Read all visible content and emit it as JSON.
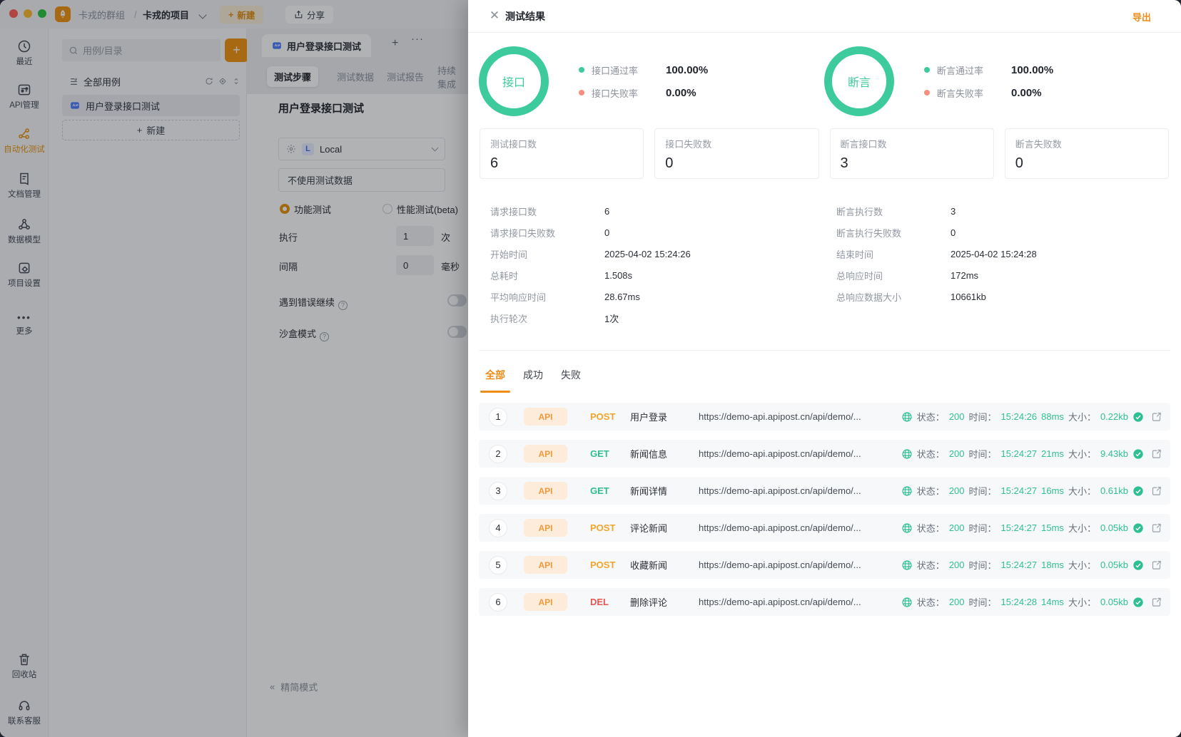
{
  "colors": {
    "primary_orange": "#f0940f",
    "accent_orange": "#ef8c1a",
    "success_green": "#3dcb9d",
    "fail_salmon": "#f88e7d",
    "method_post": "#f2a52a",
    "method_get": "#2fbe8f",
    "method_del": "#e8564f",
    "status_green": "#2fbf93"
  },
  "window_bar": {
    "group": "卡戎的群组",
    "separator": "/",
    "project": "卡戎的项目",
    "new_button": "新建",
    "share_button": "分享"
  },
  "sidebar": {
    "items": [
      {
        "label": "最近"
      },
      {
        "label": "API管理"
      },
      {
        "label": "自动化测试",
        "active": true
      },
      {
        "label": "文档管理"
      },
      {
        "label": "数据模型"
      },
      {
        "label": "项目设置"
      },
      {
        "label": "更多"
      }
    ],
    "bottom_items": [
      {
        "label": "回收站"
      },
      {
        "label": "联系客服"
      }
    ]
  },
  "tree_panel": {
    "search_placeholder": "用例/目录",
    "all_cases": "全部用例",
    "case_name": "用户登录接口测试",
    "new_label": "新建"
  },
  "editor_panel": {
    "doc_tab": "用户登录接口测试",
    "tabs": [
      "测试步骤",
      "测试数据",
      "测试报告",
      "持续集成"
    ],
    "heading": "用户登录接口测试",
    "env_badge": "L",
    "env_name": "Local",
    "data_source": "不使用测试数据",
    "mode_functional": "功能测试",
    "mode_performance": "性能测试(beta)",
    "exec_label": "执行",
    "exec_value": "1",
    "exec_unit": "次",
    "interval_label": "间隔",
    "interval_value": "0",
    "interval_unit": "毫秒",
    "continue_on_error": "遇到错误继续",
    "sandbox_mode": "沙盒模式",
    "compact_mode": "精简模式"
  },
  "modal": {
    "title": "测试结果",
    "export_label": "导出",
    "gauges": [
      {
        "ring_label": "接口",
        "pass_label": "接口通过率",
        "pass_value": "100.00%",
        "fail_label": "接口失败率",
        "fail_value": "0.00%"
      },
      {
        "ring_label": "断言",
        "pass_label": "断言通过率",
        "pass_value": "100.00%",
        "fail_label": "断言失败率",
        "fail_value": "0.00%"
      }
    ],
    "stat_cards": [
      {
        "label": "测试接口数",
        "value": "6"
      },
      {
        "label": "接口失败数",
        "value": "0"
      },
      {
        "label": "断言接口数",
        "value": "3"
      },
      {
        "label": "断言失败数",
        "value": "0"
      }
    ],
    "details_left": [
      {
        "label": "请求接口数",
        "value": "6"
      },
      {
        "label": "请求接口失败数",
        "value": "0"
      },
      {
        "label": "开始时间",
        "value": "2025-04-02 15:24:26"
      },
      {
        "label": "总耗时",
        "value": "1.508s"
      },
      {
        "label": "平均响应时间",
        "value": "28.67ms"
      },
      {
        "label": "执行轮次",
        "value": "1次"
      }
    ],
    "details_right": [
      {
        "label": "断言执行数",
        "value": "3"
      },
      {
        "label": "断言执行失败数",
        "value": "0"
      },
      {
        "label": "结束时间",
        "value": "2025-04-02 15:24:28"
      },
      {
        "label": "总响应时间",
        "value": "172ms"
      },
      {
        "label": "总响应数据大小",
        "value": "10661kb"
      }
    ],
    "tabs": [
      "全部",
      "成功",
      "失败"
    ],
    "row_labels": {
      "status": "状态：",
      "time": "时间：",
      "size": "大小："
    },
    "rows": [
      {
        "index": "1",
        "badge": "API",
        "method": "POST",
        "name": "用户登录",
        "url": "https://demo-api.apipost.cn/api/demo/...",
        "status": "200",
        "time": "15:24:26",
        "duration": "88ms",
        "size": "0.22kb"
      },
      {
        "index": "2",
        "badge": "API",
        "method": "GET",
        "name": "新闻信息",
        "url": "https://demo-api.apipost.cn/api/demo/...",
        "status": "200",
        "time": "15:24:27",
        "duration": "21ms",
        "size": "9.43kb"
      },
      {
        "index": "3",
        "badge": "API",
        "method": "GET",
        "name": "新闻详情",
        "url": "https://demo-api.apipost.cn/api/demo/...",
        "status": "200",
        "time": "15:24:27",
        "duration": "16ms",
        "size": "0.61kb"
      },
      {
        "index": "4",
        "badge": "API",
        "method": "POST",
        "name": "评论新闻",
        "url": "https://demo-api.apipost.cn/api/demo/...",
        "status": "200",
        "time": "15:24:27",
        "duration": "15ms",
        "size": "0.05kb"
      },
      {
        "index": "5",
        "badge": "API",
        "method": "POST",
        "name": "收藏新闻",
        "url": "https://demo-api.apipost.cn/api/demo/...",
        "status": "200",
        "time": "15:24:27",
        "duration": "18ms",
        "size": "0.05kb"
      },
      {
        "index": "6",
        "badge": "API",
        "method": "DEL",
        "name": "删除评论",
        "url": "https://demo-api.apipost.cn/api/demo/...",
        "status": "200",
        "time": "15:24:28",
        "duration": "14ms",
        "size": "0.05kb"
      }
    ]
  }
}
